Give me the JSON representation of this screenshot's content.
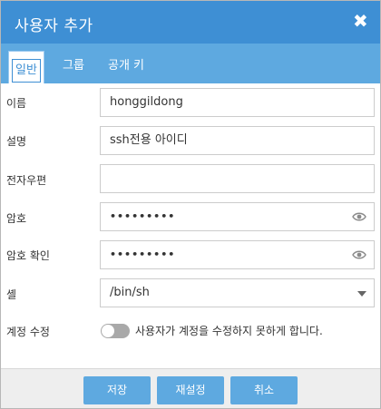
{
  "dialog": {
    "title": "사용자 추가",
    "close_icon": "close-icon"
  },
  "tabs": [
    {
      "label": "일반",
      "active": true
    },
    {
      "label": "그룹",
      "active": false
    },
    {
      "label": "공개 키",
      "active": false
    }
  ],
  "form": {
    "name_label": "이름",
    "name_value": "honggildong",
    "desc_label": "설명",
    "desc_value": "ssh전용 아이디",
    "email_label": "전자우편",
    "email_value": "",
    "password_label": "암호",
    "password_value": "•••••••••",
    "confirm_label": "암호 확인",
    "confirm_value": "•••••••••",
    "shell_label": "셸",
    "shell_value": "/bin/sh",
    "account_edit_label": "계정 수정",
    "account_edit_toggle_on": false,
    "account_edit_text": "사용자가 계정을 수정하지 못하게 합니다."
  },
  "footer": {
    "save_label": "저장",
    "reset_label": "재설정",
    "cancel_label": "취소"
  },
  "colors": {
    "header": "#3e8fd4",
    "tabbar": "#5ea9e0",
    "button": "#5ea9e0"
  }
}
